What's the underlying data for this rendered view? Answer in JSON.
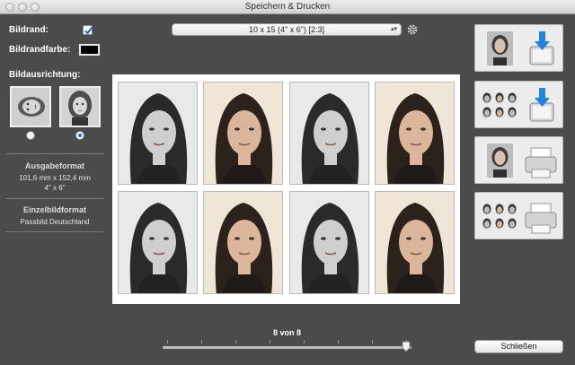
{
  "window": {
    "title": "Speichern & Drucken"
  },
  "left_panel": {
    "border_label": "Bildrand:",
    "border_checked": true,
    "border_color_label": "Bildrandfarbe:",
    "border_color": "#000000",
    "orientation_label": "Bildausrichtung:",
    "orientation_selected": "portrait",
    "output_format_heading": "Ausgabeformat",
    "output_format_mm": "101,6 mm x 152,4 mm",
    "output_format_inch": "4\" x 6\"",
    "single_format_heading": "Einzelbildformat",
    "single_format_value": "Passbild Deutschland"
  },
  "toolbar": {
    "format_select_value": "10 x 15 (4\" x 6\") [2:3]",
    "settings_icon": "gear-icon"
  },
  "sheet": {
    "photos": [
      {
        "tone": "gray"
      },
      {
        "tone": "color"
      },
      {
        "tone": "gray"
      },
      {
        "tone": "color"
      },
      {
        "tone": "gray"
      },
      {
        "tone": "color"
      },
      {
        "tone": "gray"
      },
      {
        "tone": "color"
      }
    ]
  },
  "actions": [
    {
      "name": "save-single-button",
      "kind": "save",
      "icon": "download-icon"
    },
    {
      "name": "save-sheet-button",
      "kind": "save",
      "icon": "download-icon"
    },
    {
      "name": "print-single-button",
      "kind": "print",
      "icon": "printer-icon"
    },
    {
      "name": "print-sheet-button",
      "kind": "print",
      "icon": "printer-icon"
    }
  ],
  "slider": {
    "label": "8 von 8",
    "value": 8,
    "max": 8
  },
  "close_label": "Schließen",
  "colors": {
    "background": "#4b4b4b",
    "accent": "#1c6fe0"
  }
}
